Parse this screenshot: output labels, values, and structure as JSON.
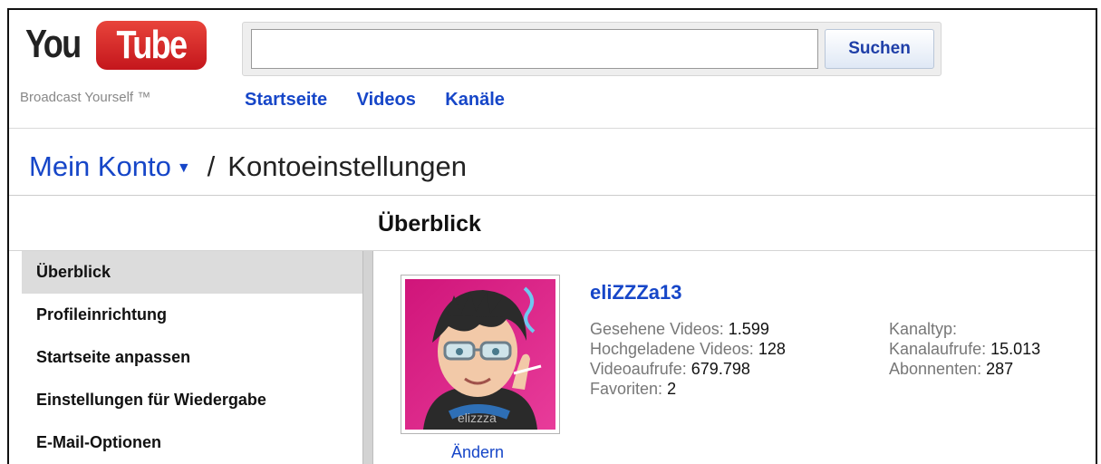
{
  "header": {
    "logo_you": "You",
    "logo_tube": "Tube",
    "tagline": "Broadcast Yourself ™",
    "search_value": "",
    "search_button": "Suchen",
    "nav": [
      "Startseite",
      "Videos",
      "Kanäle"
    ]
  },
  "breadcrumb": {
    "account": "Mein Konto",
    "separator": "/",
    "current": "Kontoeinstellungen"
  },
  "section_title": "Überblick",
  "sidebar": {
    "items": [
      {
        "label": "Überblick",
        "active": true
      },
      {
        "label": "Profileinrichtung",
        "active": false
      },
      {
        "label": "Startseite anpassen",
        "active": false
      },
      {
        "label": "Einstellungen für Wiedergabe",
        "active": false
      },
      {
        "label": "E-Mail-Optionen",
        "active": false
      }
    ]
  },
  "profile": {
    "username": "eliZZZa13",
    "avatar_label": "elizzza",
    "change_link": "Ändern",
    "stats_left": [
      {
        "label": "Gesehene Videos:",
        "value": "1.599"
      },
      {
        "label": "Hochgeladene Videos:",
        "value": "128"
      },
      {
        "label": "Videoaufrufe:",
        "value": "679.798"
      },
      {
        "label": "Favoriten:",
        "value": "2"
      }
    ],
    "stats_right": [
      {
        "label": "Kanaltyp:",
        "value": ""
      },
      {
        "label": "Kanalaufrufe:",
        "value": "15.013"
      },
      {
        "label": "Abonnenten:",
        "value": "287"
      }
    ]
  },
  "colors": {
    "link": "#1646c8",
    "logo_red": "#c4161c",
    "active_bg": "#dcdcdc"
  }
}
